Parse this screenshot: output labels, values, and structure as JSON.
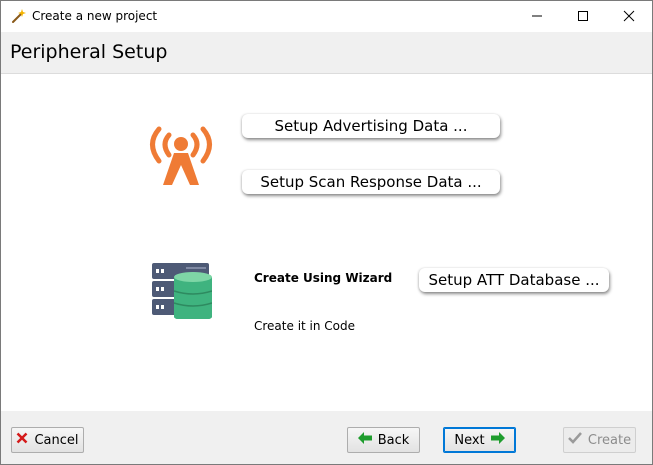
{
  "window": {
    "title": "Create a new project",
    "controls": {
      "minimize": "minimize-icon",
      "maximize": "maximize-icon",
      "close": "close-icon"
    }
  },
  "header": {
    "title": "Peripheral Setup"
  },
  "advertising": {
    "icon": "broadcast-tower-icon",
    "setup_advertising_label": "Setup Advertising Data ...",
    "setup_scan_response_label": "Setup Scan Response Data ..."
  },
  "database": {
    "icon": "server-database-icon",
    "wizard_label": "Create Using Wizard",
    "code_label": "Create it in Code",
    "setup_att_label": "Setup ATT Database ..."
  },
  "footer": {
    "cancel_label": "Cancel",
    "back_label": "Back",
    "next_label": "Next",
    "create_label": "Create"
  },
  "colors": {
    "accent_orange": "#ef7b35",
    "db_green": "#3fb37f",
    "server_slate": "#4e5a76",
    "focus_blue": "#0078d7",
    "arrow_green": "#1f9d2e",
    "cancel_red": "#d41a1a"
  }
}
